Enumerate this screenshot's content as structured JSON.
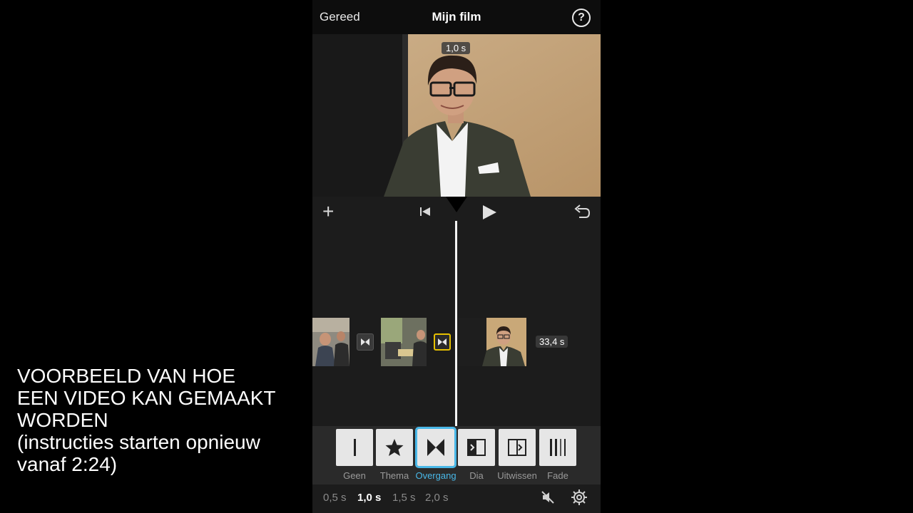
{
  "caption": {
    "line1": "VOORBEELD VAN HOE",
    "line2": "EEN VIDEO KAN GEMAAKT",
    "line3": "WORDEN",
    "line4": "(instructies starten opnieuw",
    "line5": "vanaf 2:24)"
  },
  "nav": {
    "done_label": "Gereed",
    "title": "Mijn film",
    "help_glyph": "?"
  },
  "preview": {
    "duration_badge": "1,0 s"
  },
  "controls": {
    "add_glyph": "+",
    "rewind_icon": "skip-to-start-icon",
    "play_icon": "play-icon",
    "undo_icon": "undo-icon"
  },
  "timeline": {
    "last_clip_duration": "33,4 s"
  },
  "transition_tools": [
    {
      "label": "Geen",
      "icon": "none-bar-icon"
    },
    {
      "label": "Thema",
      "icon": "star-icon"
    },
    {
      "label": "Overgang",
      "icon": "bowtie-icon"
    },
    {
      "label": "Dia",
      "icon": "slide-icon"
    },
    {
      "label": "Uitwissen",
      "icon": "wipe-icon"
    },
    {
      "label": "Fade",
      "icon": "fade-icon"
    }
  ],
  "speeds": [
    "0,5 s",
    "1,0 s",
    "1,5 s",
    "2,0 s"
  ],
  "selected_speed": "1,0 s",
  "selected_tool": "Overgang",
  "colors": {
    "accent_blue": "#49b8e8",
    "selection_yellow": "#e6c000"
  }
}
